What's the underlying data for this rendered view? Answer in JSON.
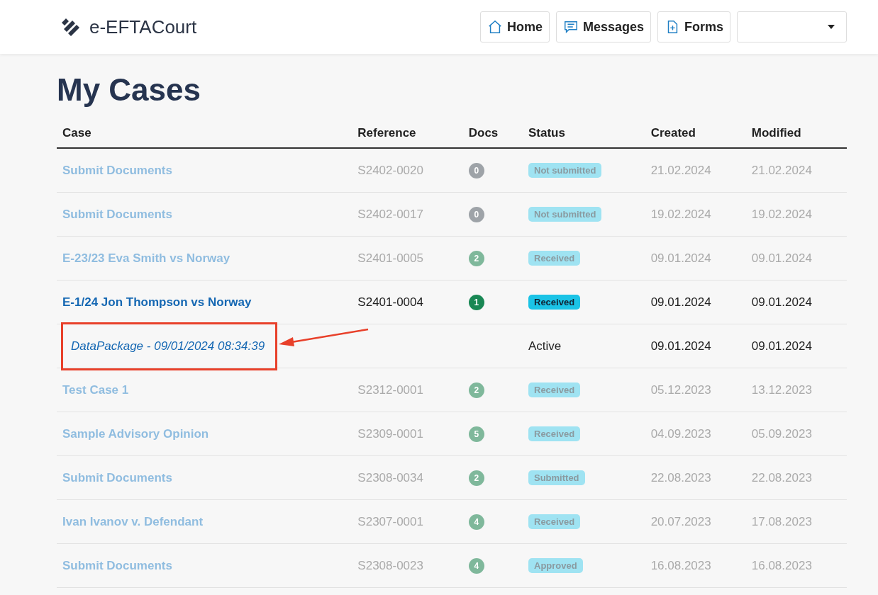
{
  "header": {
    "logo": "e-EFTACourt",
    "nav": [
      {
        "label": "Home"
      },
      {
        "label": "Messages"
      },
      {
        "label": "Forms"
      }
    ]
  },
  "title": "My Cases",
  "table": {
    "columns": [
      "Case",
      "Reference",
      "Docs",
      "Status",
      "Created",
      "Modified"
    ],
    "rows": [
      {
        "kind": "case",
        "dimmed": true,
        "annotated": false,
        "case": "Submit Documents",
        "reference": "S2402-0020",
        "docs": "0",
        "color": "#9ea3a8",
        "status": "Not submitted",
        "created": "21.02.2024",
        "modified": "21.02.2024"
      },
      {
        "kind": "case",
        "dimmed": true,
        "annotated": false,
        "case": "Submit Documents",
        "reference": "S2402-0017",
        "docs": "0",
        "color": "#9ea3a8",
        "status": "Not submitted",
        "created": "19.02.2024",
        "modified": "19.02.2024"
      },
      {
        "kind": "case",
        "dimmed": true,
        "annotated": false,
        "case": "E-23/23 Eva Smith vs Norway",
        "reference": "S2401-0005",
        "docs": "2",
        "color": "#7fb89b",
        "status": "Received",
        "created": "09.01.2024",
        "modified": "09.01.2024"
      },
      {
        "kind": "case",
        "dimmed": false,
        "annotated": false,
        "case": "E-1/24 Jon Thompson vs Norway",
        "reference": "S2401-0004",
        "docs": "1",
        "color": "#198754",
        "status": "Received",
        "created": "09.01.2024",
        "modified": "09.01.2024"
      },
      {
        "kind": "package",
        "dimmed": false,
        "annotated": true,
        "case": "DataPackage - 09/01/2024 08:34:39",
        "status": "Active",
        "created": "09.01.2024",
        "modified": "09.01.2024"
      },
      {
        "kind": "case",
        "dimmed": true,
        "annotated": false,
        "case": "Test Case 1",
        "reference": "S2312-0001",
        "docs": "2",
        "color": "#7fb89b",
        "status": "Received",
        "created": "05.12.2023",
        "modified": "13.12.2023"
      },
      {
        "kind": "case",
        "dimmed": true,
        "annotated": false,
        "case": "Sample Advisory Opinion",
        "reference": "S2309-0001",
        "docs": "5",
        "color": "#7fb89b",
        "status": "Received",
        "created": "04.09.2023",
        "modified": "05.09.2023"
      },
      {
        "kind": "case",
        "dimmed": true,
        "annotated": false,
        "case": "Submit Documents",
        "reference": "S2308-0034",
        "docs": "2",
        "color": "#7fb89b",
        "status": "Submitted",
        "created": "22.08.2023",
        "modified": "22.08.2023"
      },
      {
        "kind": "case",
        "dimmed": true,
        "annotated": false,
        "case": "Ivan Ivanov v. Defendant",
        "reference": "S2307-0001",
        "docs": "4",
        "color": "#7fb89b",
        "status": "Received",
        "created": "20.07.2023",
        "modified": "17.08.2023"
      },
      {
        "kind": "case",
        "dimmed": true,
        "annotated": false,
        "case": "Submit Documents",
        "reference": "S2308-0023",
        "docs": "4",
        "color": "#7fb89b",
        "status": "Approved",
        "created": "16.08.2023",
        "modified": "16.08.2023"
      }
    ]
  }
}
